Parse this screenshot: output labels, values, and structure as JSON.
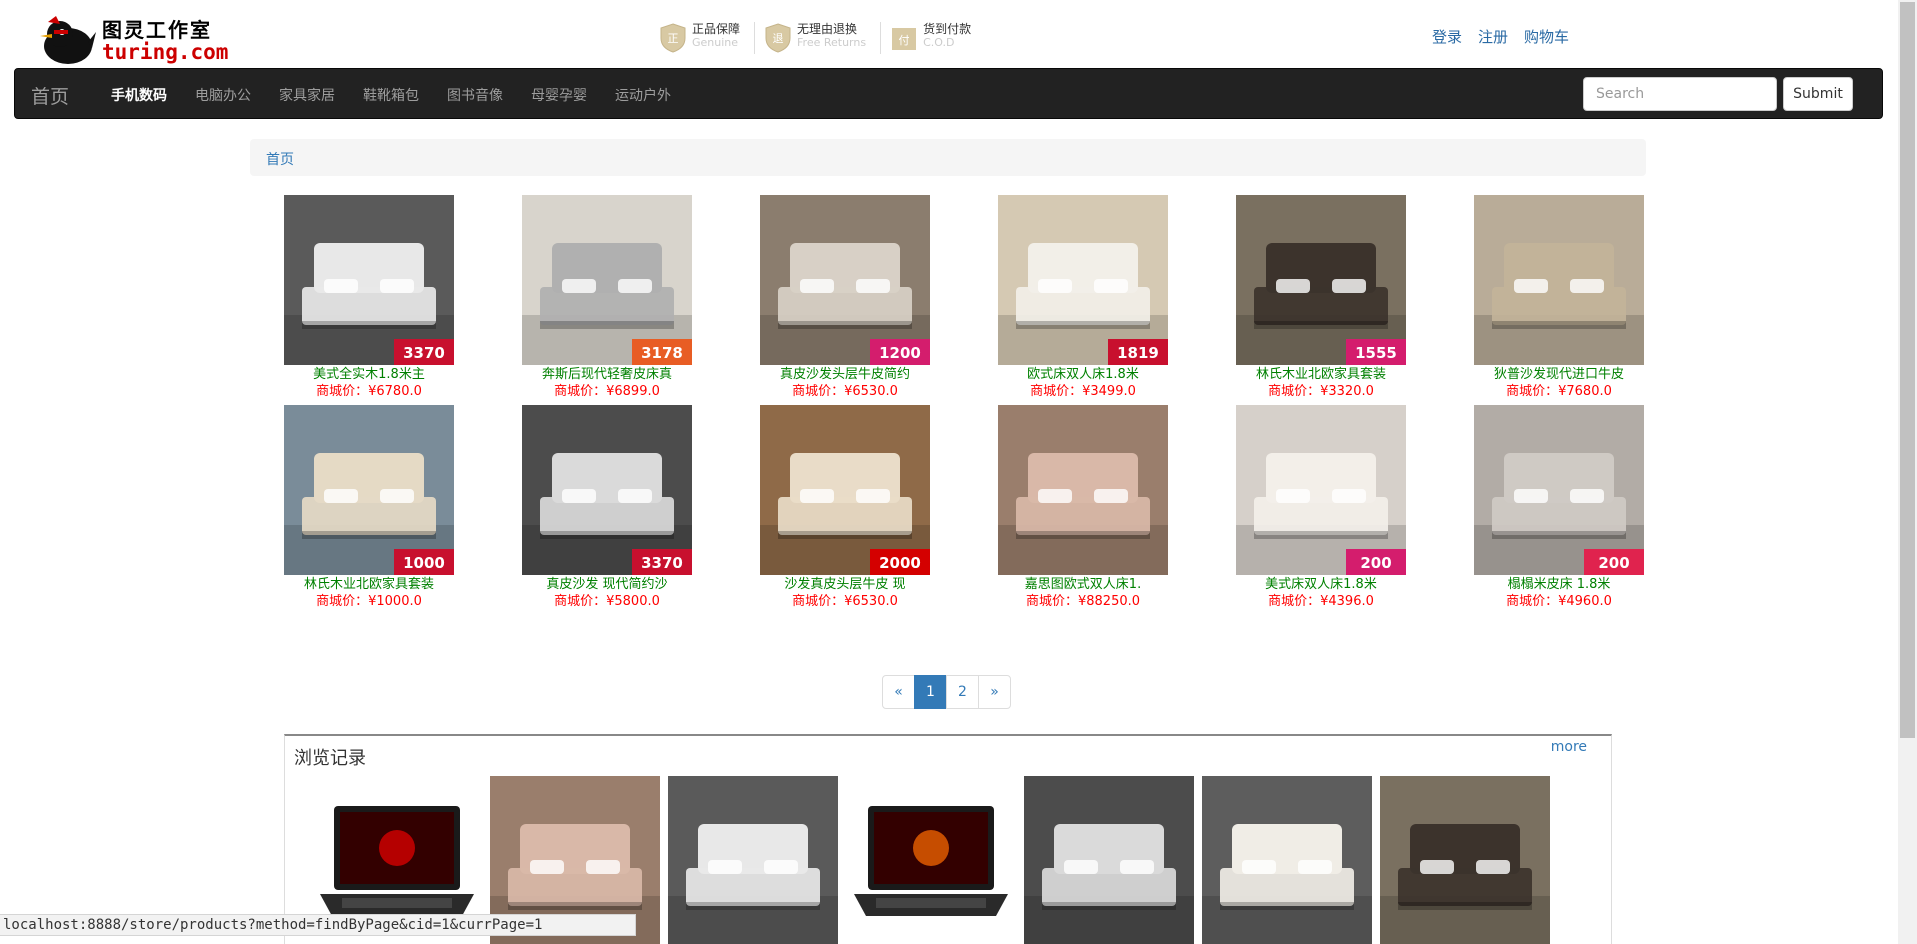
{
  "header": {
    "logo_cn": "图灵工作室",
    "logo_en": "turing.com",
    "badges": [
      {
        "title": "正品保障",
        "sub": "Genuine"
      },
      {
        "title": "无理由退换",
        "sub": "Free Returns"
      },
      {
        "title": "货到付款",
        "sub": "C.O.D"
      }
    ],
    "links": {
      "login": "登录",
      "register": "注册",
      "cart": "购物车"
    }
  },
  "nav": {
    "brand": "首页",
    "items": [
      "手机数码",
      "电脑办公",
      "家具家居",
      "鞋靴箱包",
      "图书音像",
      "母婴孕婴",
      "运动户外"
    ],
    "active_index": 0,
    "search_placeholder": "Search",
    "submit_label": "Submit"
  },
  "breadcrumb": {
    "home": "首页"
  },
  "products": [
    {
      "name": "美式全实木1.8米主",
      "price": "商城价：¥6780.0",
      "bg": "#5a5a5a",
      "bed": "#e8e8e8",
      "tag": "3370",
      "tagcolor": "#c8102e"
    },
    {
      "name": "奔斯后现代轻奢皮床真",
      "price": "商城价：¥6899.0",
      "bg": "#d8d4cc",
      "bed": "#b0b0b0",
      "tag": "3178",
      "tagcolor": "#e85d24"
    },
    {
      "name": "真皮沙发头层牛皮简约",
      "price": "商城价：¥6530.0",
      "bg": "#8b7d6e",
      "bed": "#d8d0c6",
      "tag": "1200",
      "tagcolor": "#d41d6d"
    },
    {
      "name": "欧式床双人床1.8米",
      "price": "商城价：¥3499.0",
      "bg": "#d5c9b3",
      "bed": "#f2efe8",
      "tag": "1819",
      "tagcolor": "#c8102e"
    },
    {
      "name": "林氏木业北欧家具套装",
      "price": "商城价：¥3320.0",
      "bg": "#7a7060",
      "bed": "#3c332c",
      "tag": "1555",
      "tagcolor": "#d41d6d"
    },
    {
      "name": "狄普沙发现代进口牛皮",
      "price": "商城价：¥7680.0",
      "bg": "#b9ac98",
      "bed": "#c2b399",
      "tag": "",
      "tagcolor": "#c8102e"
    },
    {
      "name": "林氏木业北欧家具套装",
      "price": "商城价：¥1000.0",
      "bg": "#7a8c99",
      "bed": "#e5dac5",
      "tag": "1000",
      "tagcolor": "#c8102e"
    },
    {
      "name": "真皮沙发 现代简约沙",
      "price": "商城价：¥5800.0",
      "bg": "#4c4c4c",
      "bed": "#dadada",
      "tag": "3370",
      "tagcolor": "#c8102e"
    },
    {
      "name": "沙发真皮头层牛皮 现",
      "price": "商城价：¥6530.0",
      "bg": "#8f6a48",
      "bed": "#e9dcc8",
      "tag": "2000",
      "tagcolor": "#d40000"
    },
    {
      "name": "嘉思图欧式双人床1.",
      "price": "商城价：¥88250.0",
      "bg": "#9a7e6c",
      "bed": "#d9b8a8",
      "tag": "",
      "tagcolor": "#c8102e"
    },
    {
      "name": "美式床双人床1.8米",
      "price": "商城价：¥4396.0",
      "bg": "#d6d0ca",
      "bed": "#f3efe9",
      "tag": "200",
      "tagcolor": "#d41d6d"
    },
    {
      "name": "榻榻米皮床 1.8米",
      "price": "商城价：¥4960.0",
      "bg": "#b2aca6",
      "bed": "#cfcac4",
      "tag": "200",
      "tagcolor": "#e0234e"
    }
  ],
  "pagination": {
    "prev": "«",
    "pages": [
      "1",
      "2"
    ],
    "current": "1",
    "next": "»"
  },
  "history": {
    "title": "浏览记录",
    "more": "more",
    "items": [
      {
        "kind": "laptop",
        "color": "#1a1a1a",
        "accent": "#c00"
      },
      {
        "kind": "bed",
        "color": "#9a7e6c",
        "accent": "#d9b8a8"
      },
      {
        "kind": "bed",
        "color": "#5a5a5a",
        "accent": "#e8e8e8"
      },
      {
        "kind": "laptop",
        "color": "#1a1a1a",
        "accent": "#e05a00"
      },
      {
        "kind": "bed",
        "color": "#4c4c4c",
        "accent": "#dadada"
      },
      {
        "kind": "bed",
        "color": "#5d5d5d",
        "accent": "#f0ede6"
      },
      {
        "kind": "bed",
        "color": "#7a7060",
        "accent": "#3c332c"
      }
    ]
  },
  "status_url": "localhost:8888/store/products?method=findByPage&cid=1&currPage=1"
}
